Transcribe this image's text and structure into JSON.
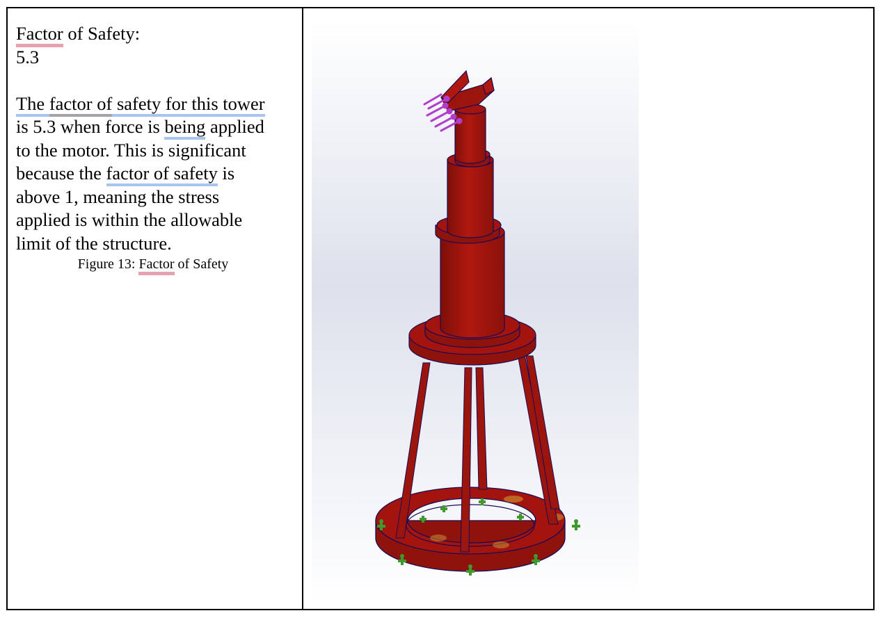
{
  "doc": {
    "heading_a": "Factor",
    "heading_b": " of Safety:",
    "value": "5.3",
    "para": {
      "s1": "The ",
      "s2": "factor",
      "s3": " of",
      "s4": " safety for this tower",
      "s5": "is 5.3 when force is ",
      "s6": "being",
      "s7": " applied",
      "s8": "to the motor. This is significant",
      "s9": "because the ",
      "s10": "factor of safety",
      "s11": " is",
      "s12": "above 1, meaning the stress",
      "s13": "applied is within the allowable",
      "s14": "limit of the structure."
    },
    "caption_a": "Figure 13: ",
    "caption_b": "Factor",
    "caption_c": " of Safety"
  },
  "colors": {
    "model_red": "#a2140d",
    "outline": "#1b0b56",
    "load_arrows": "#b23ccc",
    "fixtures": "#3f9a2e"
  }
}
